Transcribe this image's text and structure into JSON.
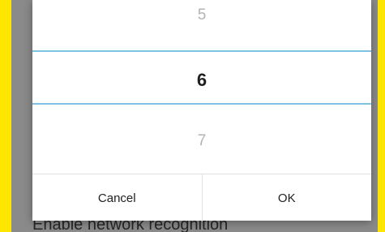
{
  "picker": {
    "previous_value": "5",
    "selected_value": "6",
    "next_value": "7"
  },
  "dialog": {
    "cancel_label": "Cancel",
    "ok_label": "OK"
  },
  "background": {
    "setting_label": "Enable network recognition"
  },
  "colors": {
    "frame": "#ffe600",
    "divider": "#7fc3e4",
    "dialog_background": "#ffffff",
    "dimmed_background": "#8a8a8a"
  }
}
